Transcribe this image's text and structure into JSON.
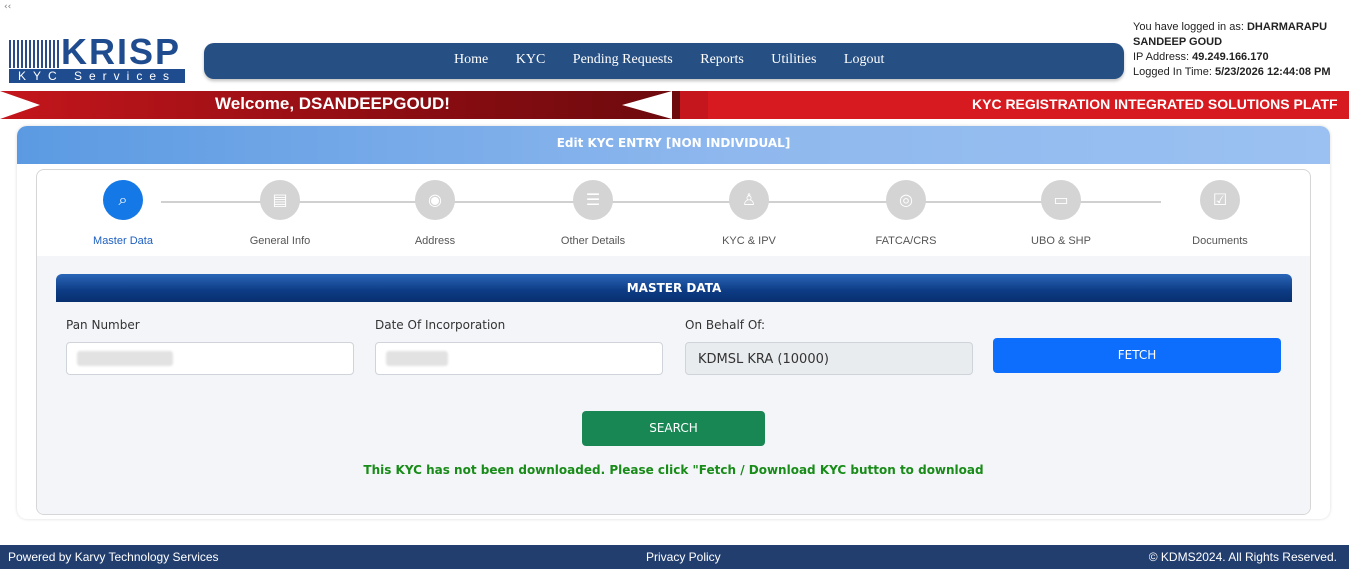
{
  "header": {
    "logo_text": "KRISP",
    "logo_sub": "KYC Services",
    "nav": [
      "Home",
      "KYC",
      "Pending Requests",
      "Reports",
      "Utilities",
      "Logout"
    ],
    "login_prefix": "You have logged in as:",
    "login_user": "DHARMARAPU SANDEEP GOUD",
    "ip_label": "IP Address:",
    "ip_value": "49.249.166.170",
    "time_label": "Logged In Time:",
    "time_value": "5/23/2026 12:44:08 PM"
  },
  "banner": {
    "welcome": "Welcome, DSANDEEPGOUD!",
    "marquee": "KYC REGISTRATION INTEGRATED SOLUTIONS PLATF"
  },
  "card": {
    "title": "Edit KYC ENTRY [NON INDIVIDUAL]",
    "steps": [
      "Master Data",
      "General Info",
      "Address",
      "Other Details",
      "KYC & IPV",
      "FATCA/CRS",
      "UBO & SHP",
      "Documents"
    ],
    "active_step": 0
  },
  "form": {
    "section_title": "MASTER DATA",
    "pan_label": "Pan Number",
    "doi_label": "Date Of Incorporation",
    "behalf_label": "On Behalf Of:",
    "behalf_value": "KDMSL KRA (10000)",
    "fetch_label": "FETCH",
    "search_label": "SEARCH",
    "message": "This KYC has not been downloaded. Please click \"Fetch / Download KYC button to download"
  },
  "footer": {
    "left": "Powered by Karvy Technology Services",
    "center": "Privacy Policy",
    "right": "© KDMS2024. All Rights Reserved."
  },
  "colors": {
    "nav_bg": "#264f84",
    "banner_red": "#d71920",
    "active_step": "#1478e6",
    "fetch": "#0d6efd",
    "search": "#198754",
    "message": "#188b18",
    "footer_bg": "#223e6f"
  },
  "icons": [
    "search-icon",
    "id-card-icon",
    "location-pin-icon",
    "list-icon",
    "user-gear-icon",
    "eye-icon",
    "card-icon",
    "document-check-icon"
  ]
}
